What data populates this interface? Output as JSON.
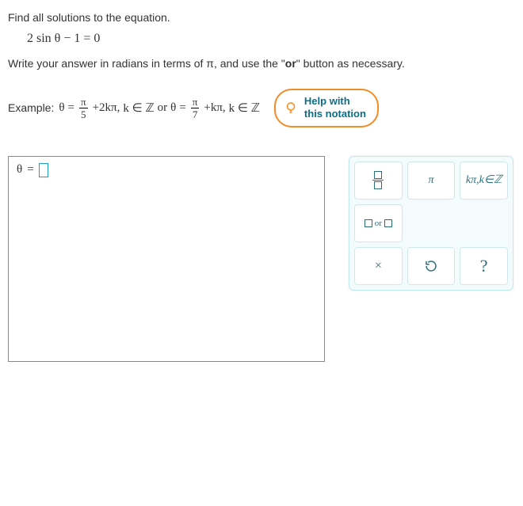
{
  "prompt": "Find all solutions to the equation.",
  "equation": "2 sin θ − 1 = 0",
  "instruction_pre": "Write your answer in radians in terms of ",
  "instruction_mid": "π",
  "instruction_post": ", and use the \"",
  "instruction_or": "or",
  "instruction_end": "\" button as necessary.",
  "example": {
    "label": "Example:",
    "theta": "θ",
    "eq": "=",
    "frac1_num": "π",
    "frac1_den": "5",
    "term1": "+2kπ,",
    "kz1": "k ∈ ℤ",
    "or": "or",
    "frac2_num": "π",
    "frac2_den": "7",
    "term2": "+kπ,",
    "kz2": "k ∈ ℤ"
  },
  "help": {
    "line1": "Help with",
    "line2": "this notation"
  },
  "answer_prefix_theta": "θ",
  "answer_prefix_eq": "=",
  "keypad": {
    "pi": "π",
    "kpi": "kπ,k∈ℤ",
    "or_text": "or",
    "times": "×",
    "question": "?"
  }
}
